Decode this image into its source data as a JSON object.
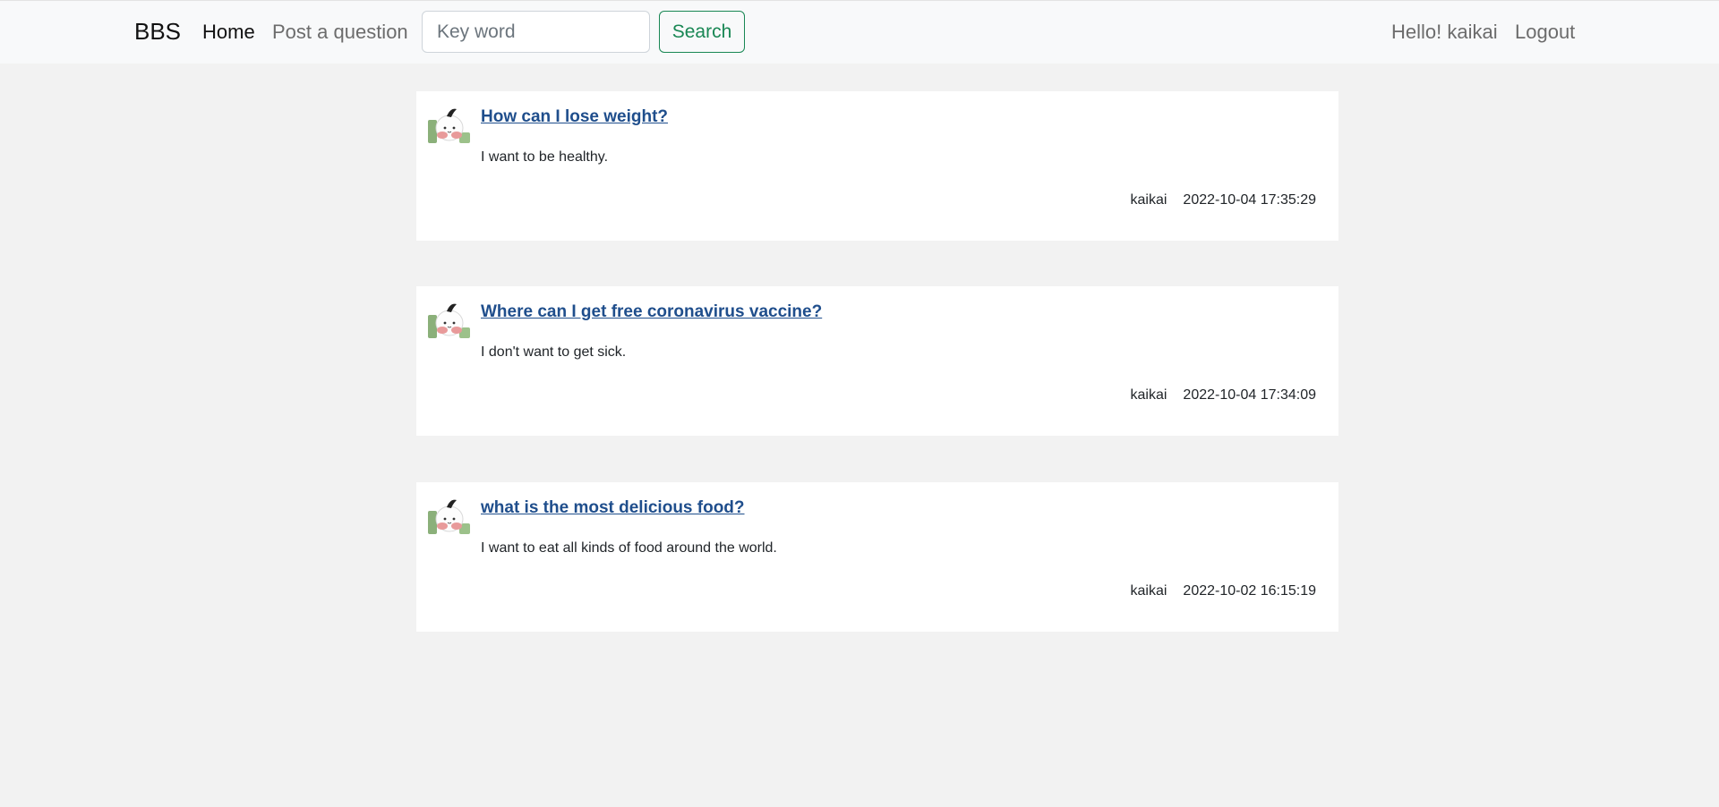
{
  "navbar": {
    "brand": "BBS",
    "links": [
      "Home",
      "Post a question"
    ],
    "search_placeholder": "Key word",
    "search_button": "Search",
    "greeting": "Hello! kaikai",
    "logout": "Logout"
  },
  "colors": {
    "link_title": "#1f4e8c",
    "search_button": "#198754",
    "page_background": "#f2f2f2",
    "navbar_background": "#f8f9fa"
  },
  "questions": [
    {
      "title": "How can I lose weight?",
      "content": "I want to be healthy.",
      "author": "kaikai",
      "time": "2022-10-04 17:35:29",
      "avatar_icon": "user-avatar-icon"
    },
    {
      "title": "Where can I get free coronavirus vaccine?",
      "content": "I don't want to get sick.",
      "author": "kaikai",
      "time": "2022-10-04 17:34:09",
      "avatar_icon": "user-avatar-icon"
    },
    {
      "title": "what is the most delicious food?",
      "content": "I want to eat all kinds of food around the world.",
      "author": "kaikai",
      "time": "2022-10-02 16:15:19",
      "avatar_icon": "user-avatar-icon"
    }
  ]
}
